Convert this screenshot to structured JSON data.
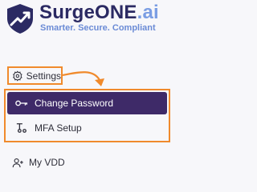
{
  "brand": {
    "name_main": "SurgeONE",
    "name_suffix": ".ai",
    "tagline": "Smarter. Secure. Compliant",
    "colors": {
      "name": "#2b2a63",
      "accent": "#7a9de3",
      "logo_shield": "#2b2a63",
      "logo_arrow": "#ffffff"
    }
  },
  "nav": {
    "settings": {
      "label": "Settings",
      "icon": "gear-icon"
    },
    "settings_submenu": [
      {
        "label": "Change Password",
        "icon": "key-icon",
        "active": true
      },
      {
        "label": "MFA Setup",
        "icon": "mfa-icon",
        "active": false
      }
    ],
    "my_vdd": {
      "label": "My VDD",
      "icon": "user-plus-icon"
    }
  },
  "highlight": {
    "color": "#f08a2c"
  },
  "active_item_color": "#3e2a68"
}
